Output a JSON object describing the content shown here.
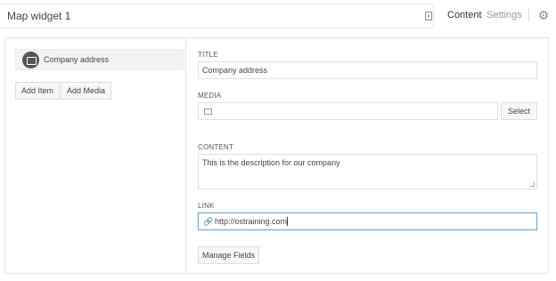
{
  "header": {
    "title": "Map widget 1",
    "tabs": [
      {
        "label": "Content",
        "active": true
      },
      {
        "label": "Settings",
        "active": false
      }
    ]
  },
  "sidebar": {
    "items": [
      {
        "label": "Company address",
        "icon": "image-icon"
      }
    ],
    "add_item_label": "Add Item",
    "add_media_label": "Add Media"
  },
  "form": {
    "title_label": "TITLE",
    "title_value": "Company address",
    "media_label": "MEDIA",
    "media_value": "",
    "select_label": "Select",
    "content_label": "CONTENT",
    "content_value": "This is the description for our company",
    "link_label": "LINK",
    "link_value": "http://ostraining.com",
    "manage_fields_label": "Manage Fields"
  },
  "colors": {
    "accent_focus": "#6ea6d6",
    "border": "#e5e5e5",
    "muted_text": "#999999"
  }
}
